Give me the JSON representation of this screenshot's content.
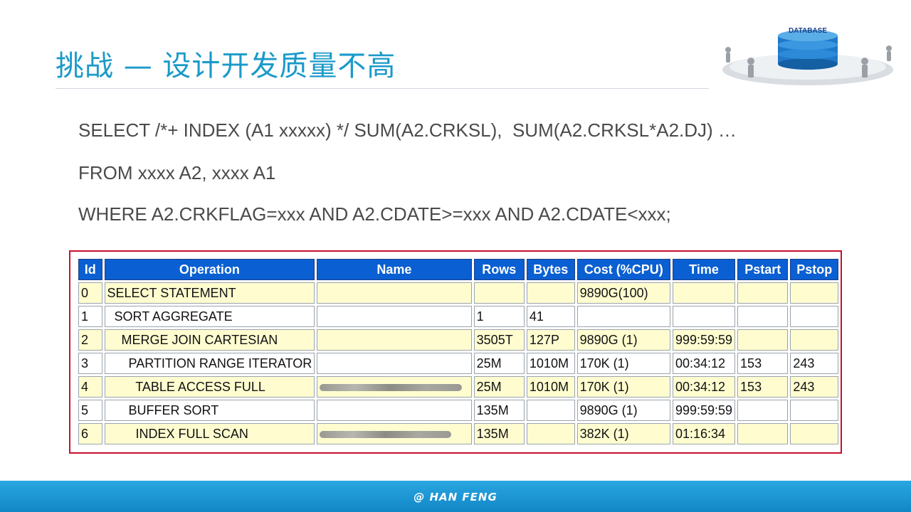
{
  "slide": {
    "title": "挑战 — 设计开发质量不高",
    "logo_label": "DATABASE",
    "sql": [
      "SELECT /*+ INDEX (A1 xxxxx) */ SUM(A2.CRKSL),  SUM(A2.CRKSL*A2.DJ) …",
      "FROM xxxx A2, xxxx A1",
      "WHERE A2.CRKFLAG=xxx AND A2.CDATE>=xxx AND A2.CDATE<xxx;"
    ],
    "footer": "@ HAN FENG"
  },
  "plan": {
    "headers": [
      "Id",
      "Operation",
      "Name",
      "Rows",
      "Bytes",
      "Cost (%CPU)",
      "Time",
      "Pstart",
      "Pstop"
    ],
    "rows": [
      [
        "0",
        "SELECT STATEMENT",
        "",
        "",
        "",
        "9890G(100)",
        "",
        "",
        ""
      ],
      [
        "1",
        "  SORT AGGREGATE",
        "",
        "1",
        "41",
        "",
        "",
        "",
        ""
      ],
      [
        "2",
        "    MERGE JOIN CARTESIAN",
        "",
        "3505T",
        "127P",
        "9890G (1)",
        "999:59:59",
        "",
        ""
      ],
      [
        "3",
        "      PARTITION RANGE ITERATOR",
        "",
        "25M",
        "1010M",
        "170K (1)",
        "00:34:12",
        "153",
        "243"
      ],
      [
        "4",
        "        TABLE ACCESS FULL",
        "",
        "25M",
        "1010M",
        "170K (1)",
        "00:34:12",
        "153",
        "243"
      ],
      [
        "5",
        "      BUFFER SORT",
        "",
        "135M",
        "",
        "9890G (1)",
        "999:59:59",
        "",
        ""
      ],
      [
        "6",
        "        INDEX FULL SCAN",
        "",
        "135M",
        "",
        "382K (1)",
        "01:16:34",
        "",
        ""
      ]
    ]
  }
}
